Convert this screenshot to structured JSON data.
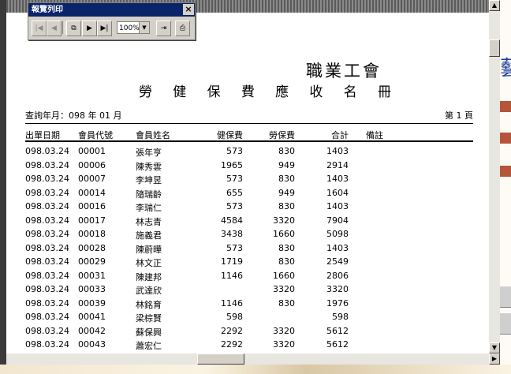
{
  "toolbar": {
    "title": "報覽列印",
    "close": "×",
    "first_icon": "first-page-icon",
    "prev_icon": "prev-page-icon",
    "copy_icon": "multi-page-icon",
    "next_icon": "next-page-icon",
    "last_icon": "last-page-icon",
    "zoom": "100%",
    "export_icon": "export-icon",
    "print_icon": "printer-icon",
    "first_glyph": "|◀",
    "prev_glyph": "◀",
    "copy_glyph": "⧉",
    "next_glyph": "▶",
    "last_glyph": "▶|",
    "export_glyph": "⇥",
    "print_glyph": "⎙",
    "zoom_arrow": "▼"
  },
  "report": {
    "company": "職業工會",
    "title_chars": [
      "勞",
      "健",
      "保",
      "費",
      "應",
      "收",
      "名",
      "冊"
    ],
    "query_label": "查詢年月：098 年 01 月",
    "page_label": "第 1 頁",
    "columns": [
      "出單日期",
      "會員代號",
      "會員姓名",
      "健保費",
      "勞保費",
      "合計",
      "備註"
    ],
    "rows": [
      [
        "098.03.24",
        "00001",
        "張年亨",
        "573",
        "830",
        "1403",
        ""
      ],
      [
        "098.03.24",
        "00006",
        "陳秀雲",
        "1965",
        "949",
        "2914",
        ""
      ],
      [
        "098.03.24",
        "00007",
        "李坤昱",
        "573",
        "830",
        "1403",
        ""
      ],
      [
        "098.03.24",
        "00014",
        "隨瑞齡",
        "655",
        "949",
        "1604",
        ""
      ],
      [
        "098.03.24",
        "00016",
        "李瑞仁",
        "573",
        "830",
        "1403",
        ""
      ],
      [
        "098.03.24",
        "00017",
        "林志青",
        "4584",
        "3320",
        "7904",
        ""
      ],
      [
        "098.03.24",
        "00018",
        "施義君",
        "3438",
        "1660",
        "5098",
        ""
      ],
      [
        "098.03.24",
        "00028",
        "陳蔚曄",
        "573",
        "830",
        "1403",
        ""
      ],
      [
        "098.03.24",
        "00029",
        "林文正",
        "1719",
        "830",
        "2549",
        ""
      ],
      [
        "098.03.24",
        "00031",
        "陳建邦",
        "1146",
        "1660",
        "2806",
        ""
      ],
      [
        "098.03.24",
        "00033",
        "武達欣",
        "",
        "3320",
        "3320",
        ""
      ],
      [
        "098.03.24",
        "00039",
        "林銘育",
        "1146",
        "830",
        "1976",
        ""
      ],
      [
        "098.03.24",
        "00041",
        "梁棕賢",
        "598",
        "",
        "598",
        ""
      ],
      [
        "098.03.24",
        "00042",
        "蘇保興",
        "2292",
        "3320",
        "5612",
        ""
      ],
      [
        "098.03.24",
        "00043",
        "蕭宏仁",
        "2292",
        "3320",
        "5612",
        ""
      ]
    ]
  },
  "scrollbars": {
    "up": "▲",
    "down": "▼",
    "right": "▶"
  }
}
